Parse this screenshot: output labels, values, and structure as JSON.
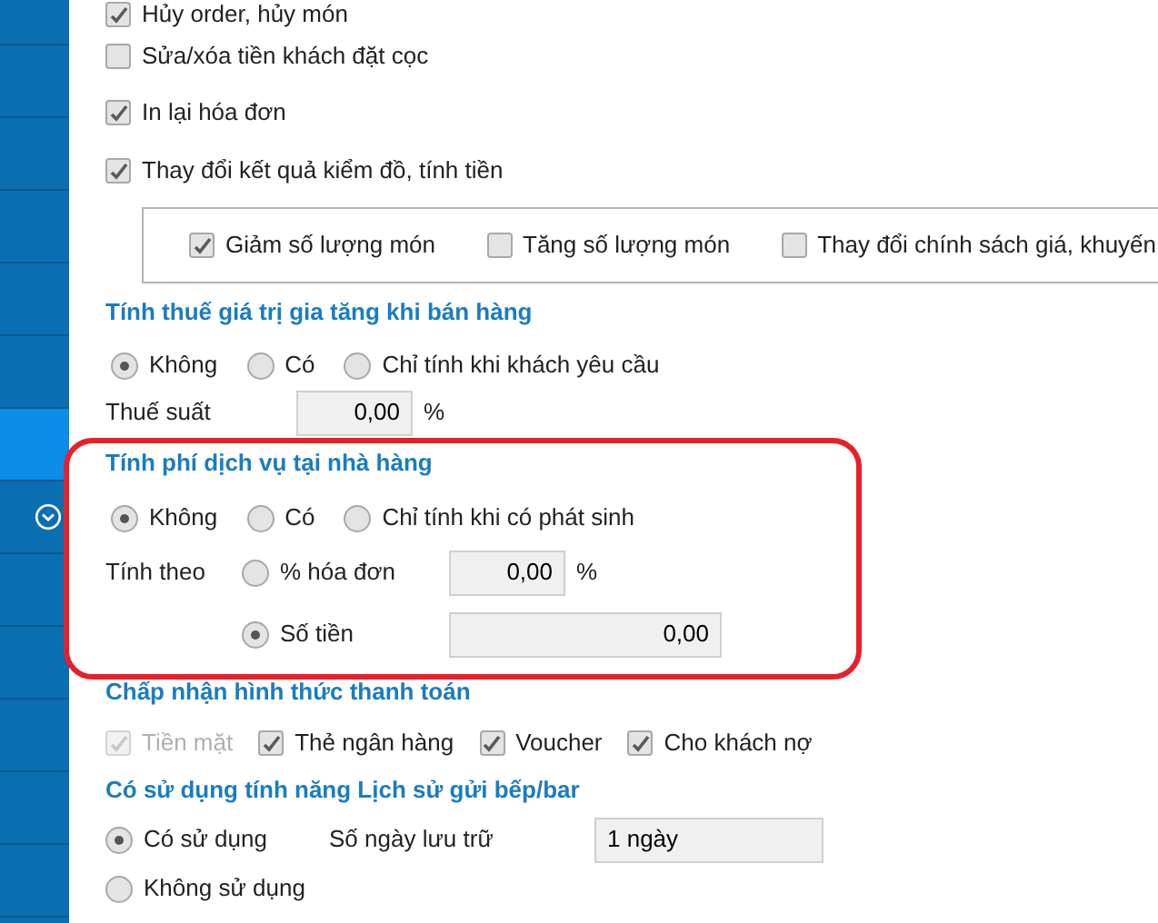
{
  "sidebar": {
    "items": [
      {
        "selected": false,
        "kind": "plain"
      },
      {
        "selected": false,
        "kind": "plain"
      },
      {
        "selected": false,
        "kind": "plain"
      },
      {
        "selected": false,
        "kind": "plain"
      },
      {
        "selected": false,
        "kind": "plain"
      },
      {
        "selected": false,
        "kind": "plain"
      },
      {
        "selected": true,
        "kind": "plain"
      },
      {
        "selected": false,
        "kind": "expand"
      },
      {
        "selected": false,
        "kind": "plain"
      },
      {
        "selected": false,
        "kind": "plain"
      },
      {
        "selected": false,
        "kind": "plain"
      },
      {
        "selected": false,
        "kind": "plain"
      },
      {
        "selected": false,
        "kind": "plain"
      }
    ]
  },
  "permissions": [
    {
      "label": "Hủy order, hủy món",
      "checked": true
    },
    {
      "label": "Sửa/xóa tiền khách đặt cọc",
      "checked": false
    },
    {
      "label": "In lại hóa đơn",
      "checked": true
    },
    {
      "label": "Thay đổi kết quả kiểm đồ, tính tiền",
      "checked": true
    }
  ],
  "sub_options": [
    {
      "label": "Giảm số lượng món",
      "checked": true
    },
    {
      "label": "Tăng số lượng món",
      "checked": false
    },
    {
      "label": "Thay đổi chính sách giá, khuyến",
      "checked": false
    }
  ],
  "vat": {
    "title": "Tính thuế giá trị gia tăng khi bán hàng",
    "options": [
      {
        "label": "Không",
        "selected": true
      },
      {
        "label": "Có",
        "selected": false
      },
      {
        "label": "Chỉ tính khi khách yêu cầu",
        "selected": false
      }
    ],
    "rate_label": "Thuế suất",
    "rate_value": "0,00",
    "unit": "%"
  },
  "service_fee": {
    "title": "Tính phí dịch vụ tại nhà hàng",
    "highlighted": true,
    "options": [
      {
        "label": "Không",
        "selected": true
      },
      {
        "label": "Có",
        "selected": false
      },
      {
        "label": "Chỉ tính khi có phát sinh",
        "selected": false
      }
    ],
    "basis_label": "Tính theo",
    "basis_options": [
      {
        "label": "% hóa đơn",
        "selected": false,
        "value": "0,00",
        "unit": "%"
      },
      {
        "label": "Số tiền",
        "selected": true,
        "value": "0,00"
      }
    ]
  },
  "payment": {
    "title": "Chấp nhận hình thức thanh toán",
    "methods": [
      {
        "label": "Tiền mặt",
        "checked": true,
        "disabled": true
      },
      {
        "label": "Thẻ ngân hàng",
        "checked": true,
        "disabled": false
      },
      {
        "label": "Voucher",
        "checked": true,
        "disabled": false
      },
      {
        "label": "Cho khách nợ",
        "checked": true,
        "disabled": false
      }
    ]
  },
  "history": {
    "title": "Có sử dụng tính năng Lịch sử gửi bếp/bar",
    "options": [
      {
        "label": "Có sử dụng",
        "selected": true
      },
      {
        "label": "Không sử dụng",
        "selected": false
      }
    ],
    "days_label": "Số ngày lưu trữ",
    "days_value": "1 ngày"
  }
}
